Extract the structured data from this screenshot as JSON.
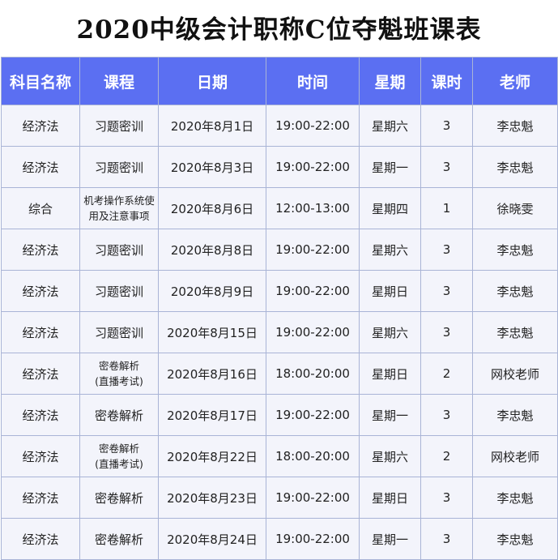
{
  "title": "2020中级会计职称C位夺魁班课表",
  "colors": {
    "header_bg": "#5b6ff2",
    "row_bg": "#f3f4fb",
    "border": "#a9b4d6"
  },
  "columns": [
    "科目名称",
    "课程",
    "日期",
    "时间",
    "星期",
    "课时",
    "老师"
  ],
  "rows": [
    {
      "subject": "经济法",
      "course": [
        "习题密训"
      ],
      "date": "2020年8月1日",
      "time": "19:00-22:00",
      "weekday": "星期六",
      "hours": "3",
      "teacher": "李忠魁"
    },
    {
      "subject": "经济法",
      "course": [
        "习题密训"
      ],
      "date": "2020年8月3日",
      "time": "19:00-22:00",
      "weekday": "星期一",
      "hours": "3",
      "teacher": "李忠魁"
    },
    {
      "subject": "综合",
      "course": [
        "机考操作系统使",
        "用及注意事项"
      ],
      "date": "2020年8月6日",
      "time": "12:00-13:00",
      "weekday": "星期四",
      "hours": "1",
      "teacher": "徐晓雯"
    },
    {
      "subject": "经济法",
      "course": [
        "习题密训"
      ],
      "date": "2020年8月8日",
      "time": "19:00-22:00",
      "weekday": "星期六",
      "hours": "3",
      "teacher": "李忠魁"
    },
    {
      "subject": "经济法",
      "course": [
        "习题密训"
      ],
      "date": "2020年8月9日",
      "time": "19:00-22:00",
      "weekday": "星期日",
      "hours": "3",
      "teacher": "李忠魁"
    },
    {
      "subject": "经济法",
      "course": [
        "习题密训"
      ],
      "date": "2020年8月15日",
      "time": "19:00-22:00",
      "weekday": "星期六",
      "hours": "3",
      "teacher": "李忠魁"
    },
    {
      "subject": "经济法",
      "course": [
        "密卷解析",
        "(直播考试)"
      ],
      "date": "2020年8月16日",
      "time": "18:00-20:00",
      "weekday": "星期日",
      "hours": "2",
      "teacher": "网校老师"
    },
    {
      "subject": "经济法",
      "course": [
        "密卷解析"
      ],
      "date": "2020年8月17日",
      "time": "19:00-22:00",
      "weekday": "星期一",
      "hours": "3",
      "teacher": "李忠魁"
    },
    {
      "subject": "经济法",
      "course": [
        "密卷解析",
        "(直播考试)"
      ],
      "date": "2020年8月22日",
      "time": "18:00-20:00",
      "weekday": "星期六",
      "hours": "2",
      "teacher": "网校老师"
    },
    {
      "subject": "经济法",
      "course": [
        "密卷解析"
      ],
      "date": "2020年8月23日",
      "time": "19:00-22:00",
      "weekday": "星期日",
      "hours": "3",
      "teacher": "李忠魁"
    },
    {
      "subject": "经济法",
      "course": [
        "密卷解析"
      ],
      "date": "2020年8月24日",
      "time": "19:00-22:00",
      "weekday": "星期一",
      "hours": "3",
      "teacher": "李忠魁"
    }
  ]
}
